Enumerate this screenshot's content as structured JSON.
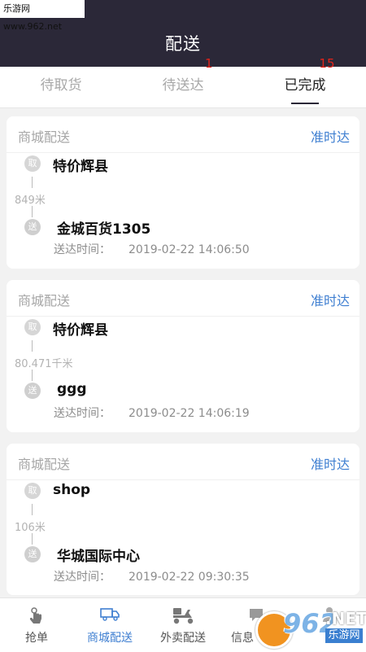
{
  "watermark": "乐游网 www.962.net",
  "header": {
    "title": "配送"
  },
  "tabs": [
    {
      "label": "待取货",
      "badge": ""
    },
    {
      "label": "待送达",
      "badge": "1"
    },
    {
      "label": "已完成",
      "badge": "15"
    }
  ],
  "orders": [
    {
      "type": "商城配送",
      "status": "准时达",
      "pick_icon": "取",
      "pickup": "特价辉县",
      "distance": "849米",
      "drop_icon": "送",
      "dropoff": "金城百货1305",
      "time_label": "送达时间：",
      "time": "2019-02-22 14:06:50"
    },
    {
      "type": "商城配送",
      "status": "准时达",
      "pick_icon": "取",
      "pickup": "特价辉县",
      "distance": "80.471千米",
      "drop_icon": "送",
      "dropoff": "ggg",
      "time_label": "送达时间：",
      "time": "2019-02-22 14:06:19"
    },
    {
      "type": "商城配送",
      "status": "准时达",
      "pick_icon": "取",
      "pickup": "shop",
      "distance": "106米",
      "drop_icon": "送",
      "dropoff": "华城国际中心",
      "time_label": "送达时间：",
      "time": "2019-02-22 09:30:35"
    }
  ],
  "bottom_nav": [
    {
      "label": "抢单",
      "icon": "hand-tap-icon"
    },
    {
      "label": "商城配送",
      "icon": "delivery-truck-icon",
      "active": true
    },
    {
      "label": "外卖配送",
      "icon": "scooter-icon"
    },
    {
      "label": "信息",
      "icon": "message-icon"
    },
    {
      "label": "",
      "icon": "person-icon"
    }
  ],
  "logo": {
    "num": "962",
    "net": ".NET",
    "cn": "乐游网"
  },
  "colors": {
    "header_bg": "#2b2838",
    "accent": "#3f7fd1",
    "badge": "#e2231a"
  }
}
